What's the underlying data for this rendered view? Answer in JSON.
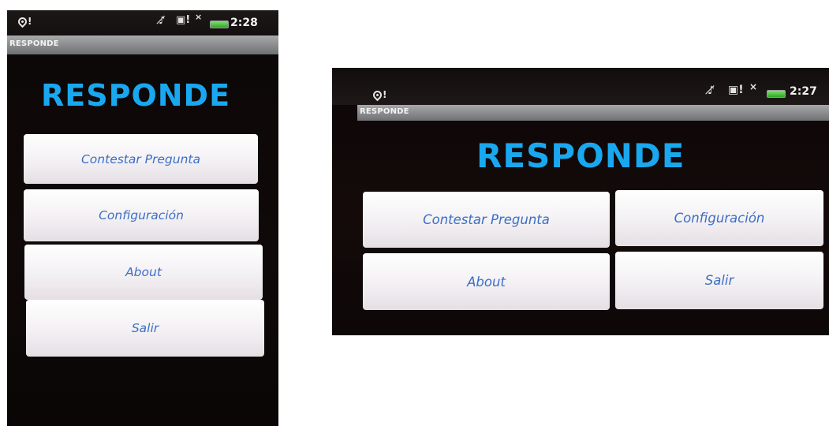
{
  "portrait": {
    "status": {
      "alert_icon": "!",
      "time": "2:28"
    },
    "title_bar": "RESPONDE",
    "app_title": "RESPONDE",
    "buttons": [
      "Contestar Pregunta",
      "Configuración",
      "About",
      "Salir"
    ]
  },
  "landscape": {
    "status": {
      "alert_icon": "!",
      "time": "2:27"
    },
    "title_bar": "RESPONDE",
    "app_title": "RESPONDE",
    "buttons": [
      "Contestar Pregunta",
      "Configuración",
      "About",
      "Salir"
    ]
  },
  "icons": {
    "notification": "location-alert-icon",
    "no_sound": "mute-icon",
    "message": "message-alert-icon",
    "signal": "no-signal-icon",
    "battery": "battery-icon"
  },
  "colors": {
    "title_blue": "#19a8f0",
    "button_text": "#3b6fc4",
    "battery_green": "#3cb834",
    "background": "#0c0707"
  }
}
